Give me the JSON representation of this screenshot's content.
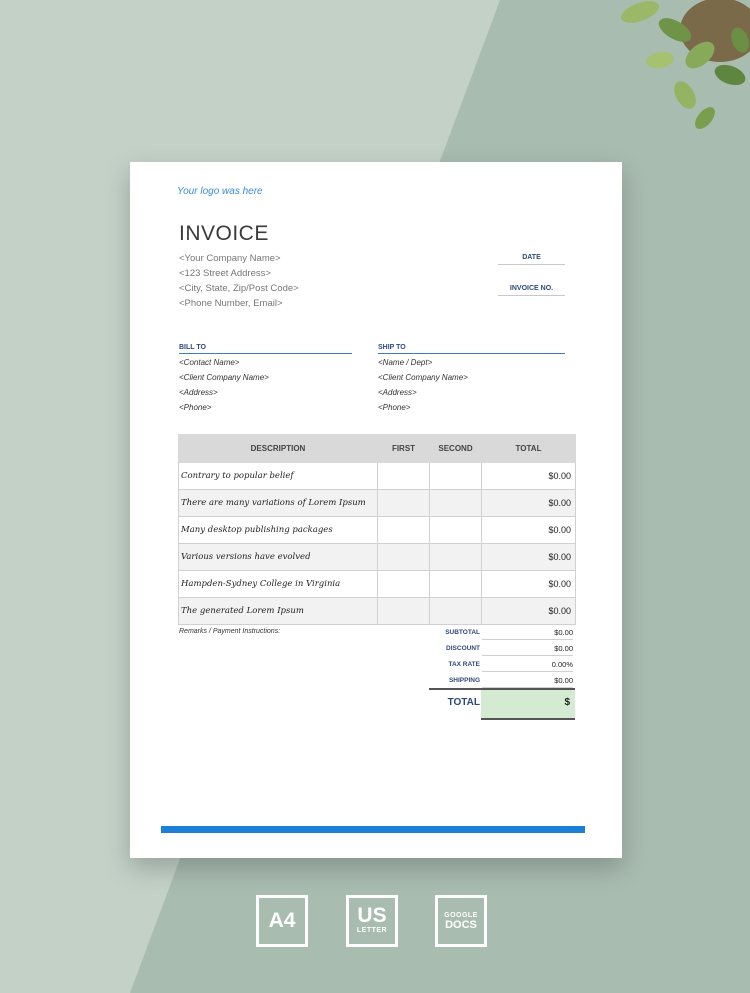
{
  "document": {
    "logo_text": "Your logo was here",
    "title": "INVOICE",
    "company": {
      "name": "<Your Company Name>",
      "street": "<123 Street Address>",
      "city": "<City, State, Zip/Post Code>",
      "phone": "<Phone Number, Email>"
    },
    "meta": {
      "date_label": "DATE",
      "invoice_no_label": "INVOICE NO."
    },
    "bill_to": {
      "heading": "BILL TO",
      "lines": [
        "<Contact Name>",
        "<Client Company Name>",
        "<Address>",
        "<Phone>"
      ]
    },
    "ship_to": {
      "heading": "SHIP TO",
      "lines": [
        "<Name / Dept>",
        "<Client Company Name>",
        "<Address>",
        "<Phone>"
      ]
    },
    "table": {
      "headers": [
        "DESCRIPTION",
        "FIRST",
        "SECOND",
        "TOTAL"
      ],
      "rows": [
        {
          "description": "Contrary to popular belief",
          "first": "",
          "second": "",
          "total": "$0.00"
        },
        {
          "description": "There are many variations of Lorem Ipsum",
          "first": "",
          "second": "",
          "total": "$0.00"
        },
        {
          "description": "Many desktop publishing packages",
          "first": "",
          "second": "",
          "total": "$0.00"
        },
        {
          "description": "Various versions have evolved",
          "first": "",
          "second": "",
          "total": "$0.00"
        },
        {
          "description": "Hampden-Sydney College in Virginia",
          "first": "",
          "second": "",
          "total": "$0.00"
        },
        {
          "description": "The generated Lorem Ipsum",
          "first": "",
          "second": "",
          "total": "$0.00"
        }
      ]
    },
    "remarks_label": "Remarks / Payment Instructions:",
    "summary": {
      "subtotal_label": "SUBTOTAL",
      "subtotal": "$0.00",
      "discount_label": "DISCOUNT",
      "discount": "$0.00",
      "tax_rate_label": "TAX RATE",
      "tax_rate": "0.00%",
      "shipping_label": "SHIPPING",
      "shipping": "$0.00",
      "total_label": "TOTAL",
      "total": "$"
    }
  },
  "badges": {
    "a4": "A4",
    "us_big": "US",
    "us_small": "LETTER",
    "gdocs_line1": "GOOGLE",
    "gdocs_line2": "DOCS"
  },
  "colors": {
    "accent_blue": "#1e7fd6",
    "heading_navy": "#2c4a7a",
    "total_fill": "#d5ead2",
    "background": "#9fb3a6"
  }
}
